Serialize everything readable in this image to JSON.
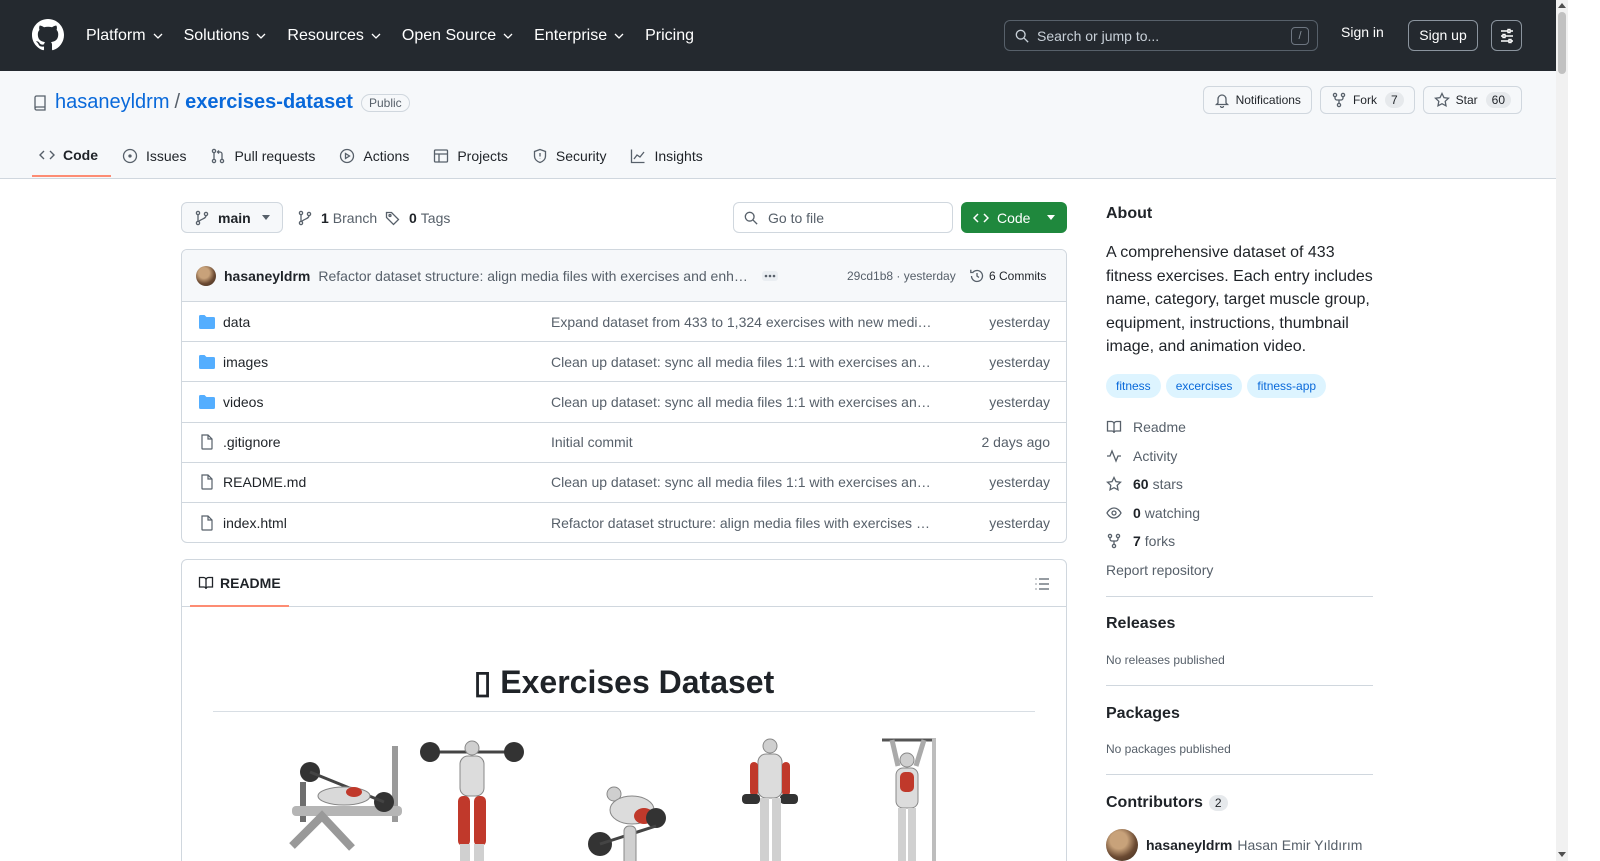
{
  "header": {
    "nav": [
      "Platform",
      "Solutions",
      "Resources",
      "Open Source",
      "Enterprise",
      "Pricing"
    ],
    "search_placeholder": "Search or jump to...",
    "search_key": "/",
    "sign_in": "Sign in",
    "sign_up": "Sign up"
  },
  "repo": {
    "owner": "hasaneyldrm",
    "separator": "/",
    "name": "exercises-dataset",
    "visibility": "Public",
    "notifications_label": "Notifications",
    "fork_label": "Fork",
    "fork_count": "7",
    "star_label": "Star",
    "star_count": "60",
    "tabs": [
      "Code",
      "Issues",
      "Pull requests",
      "Actions",
      "Projects",
      "Security",
      "Insights"
    ]
  },
  "toolbar": {
    "branch": "main",
    "branch_count": "1",
    "branch_label": "Branch",
    "tag_count": "0",
    "tag_label": "Tags",
    "goto_placeholder": "Go to file",
    "code_label": "Code"
  },
  "commit": {
    "author": "hasaneyldrm",
    "message": "Refactor dataset structure: align media files with exercises and enhance documentation",
    "hash_time": "29cd1b8 · yesterday",
    "commits_label": "6 Commits"
  },
  "files": [
    {
      "type": "dir",
      "name": "data",
      "message": "Expand dataset from 433 to 1,324 exercises with new media files",
      "date": "yesterday"
    },
    {
      "type": "dir",
      "name": "images",
      "message": "Clean up dataset: sync all media files 1:1 with exercises and remove unused",
      "date": "yesterday"
    },
    {
      "type": "dir",
      "name": "videos",
      "message": "Clean up dataset: sync all media files 1:1 with exercises and remove unused",
      "date": "yesterday"
    },
    {
      "type": "file",
      "name": ".gitignore",
      "message": "Initial commit",
      "date": "2 days ago"
    },
    {
      "type": "file",
      "name": "README.md",
      "message": "Clean up dataset: sync all media files 1:1 with exercises and remove unused",
      "date": "yesterday"
    },
    {
      "type": "file",
      "name": "index.html",
      "message": "Refactor dataset structure: align media files with exercises and enhance docs",
      "date": "yesterday"
    }
  ],
  "readme": {
    "tab_label": "README",
    "title": "▯ Exercises Dataset"
  },
  "sidebar": {
    "about_heading": "About",
    "description": "A comprehensive dataset of 433 fitness exercises. Each entry includes name, category, target muscle group, equipment, instructions, thumbnail image, and animation video.",
    "topics": [
      "fitness",
      "excercises",
      "fitness-app"
    ],
    "readme_link": "Readme",
    "activity_link": "Activity",
    "stars_count": "60",
    "stars_label": "stars",
    "watching_count": "0",
    "watching_label": "watching",
    "forks_count": "7",
    "forks_label": "forks",
    "report_link": "Report repository",
    "releases_heading": "Releases",
    "releases_note": "No releases published",
    "packages_heading": "Packages",
    "packages_note": "No packages published",
    "contributors_heading": "Contributors",
    "contributors_count": "2",
    "contributor_login": "hasaneyldrm",
    "contributor_name": "Hasan Emir Yıldırım"
  },
  "colors": {
    "header_bg": "#24292f",
    "link": "#0969da",
    "primary_button": "#1f883d",
    "active_tab_underline": "#fd8c73",
    "folder": "#54aeff",
    "topic_bg": "#ddf4ff"
  }
}
